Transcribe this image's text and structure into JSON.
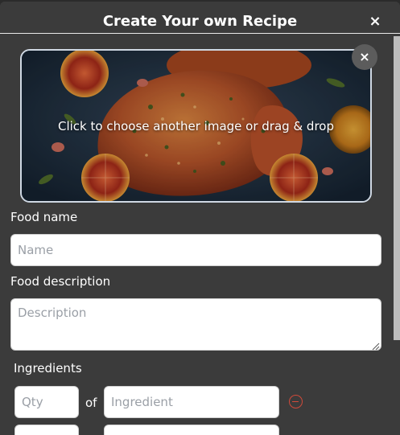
{
  "modal": {
    "title": "Create Your own Recipe",
    "close_label": "×"
  },
  "image_upload": {
    "label": "Click to choose another image or drag & drop",
    "remove_label": "×"
  },
  "form": {
    "food_name_label": "Food name",
    "food_name_placeholder": "Name",
    "food_description_label": "Food description",
    "food_description_placeholder": "Description",
    "ingredients_label": "Ingredients",
    "ingredient_rows": [
      {
        "qty_placeholder": "Qty",
        "of_text": "of",
        "ingredient_placeholder": "Ingredient"
      }
    ]
  },
  "colors": {
    "modal_bg": "#3b3b3b",
    "remove_icon": "#d04a3a"
  }
}
